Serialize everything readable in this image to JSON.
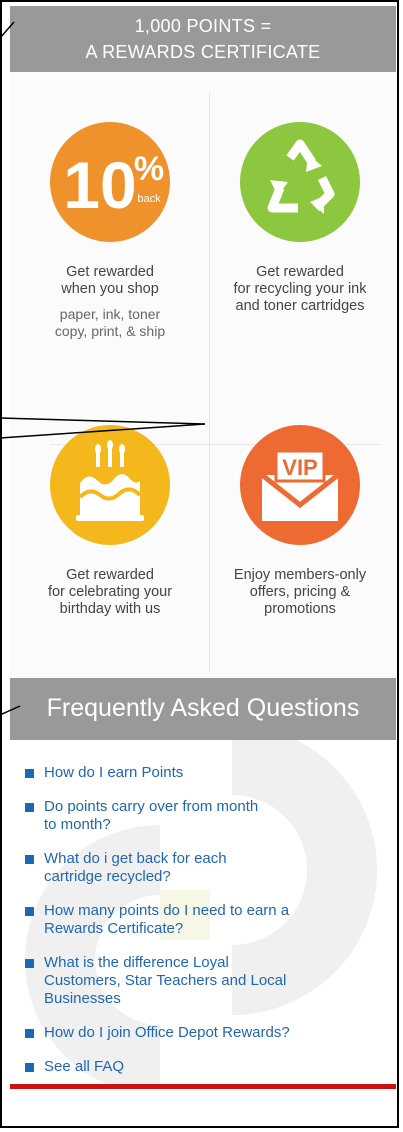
{
  "banner": {
    "line1": "1,000 POINTS =",
    "line2": "A REWARDS CERTIFICATE"
  },
  "features": [
    {
      "icon": "ten-percent-back-icon",
      "icon_main": "10",
      "icon_pct": "%",
      "icon_sub": "back",
      "title_lines": [
        "Get rewarded",
        "when you shop"
      ],
      "subtitle_lines": [
        "paper, ink, toner",
        "copy, print, & ship"
      ],
      "color": "#f0922b"
    },
    {
      "icon": "recycle-icon",
      "title_lines": [
        "Get rewarded",
        "for recycling your ink",
        "and toner cartridges"
      ],
      "color": "#8dc63f"
    },
    {
      "icon": "birthday-cake-icon",
      "title_lines": [
        "Get rewarded",
        "for celebrating your",
        "birthday with us"
      ],
      "color": "#f4b81c"
    },
    {
      "icon": "vip-envelope-icon",
      "icon_text": "VIP",
      "title_lines": [
        "Enjoy members-only",
        "offers, pricing &",
        "promotions"
      ],
      "color": "#ee6a33"
    }
  ],
  "faq": {
    "heading": "Frequently Asked Questions",
    "items": [
      [
        "How do I earn Points"
      ],
      [
        "Do points carry over from month",
        "to month?"
      ],
      [
        "What do i get back for each",
        "cartridge recycled?"
      ],
      [
        "How many points do I need to earn a",
        "Rewards Certificate?"
      ],
      [
        "What is the difference Loyal",
        "Customers, Star Teachers and Local",
        "Businesses"
      ],
      [
        "How do I join Office Depot Rewards?"
      ],
      [
        "See all FAQ"
      ]
    ],
    "link_color": "#1f66b5"
  },
  "colors": {
    "banner_gray": "#999999",
    "accent_red": "#cc1111"
  }
}
